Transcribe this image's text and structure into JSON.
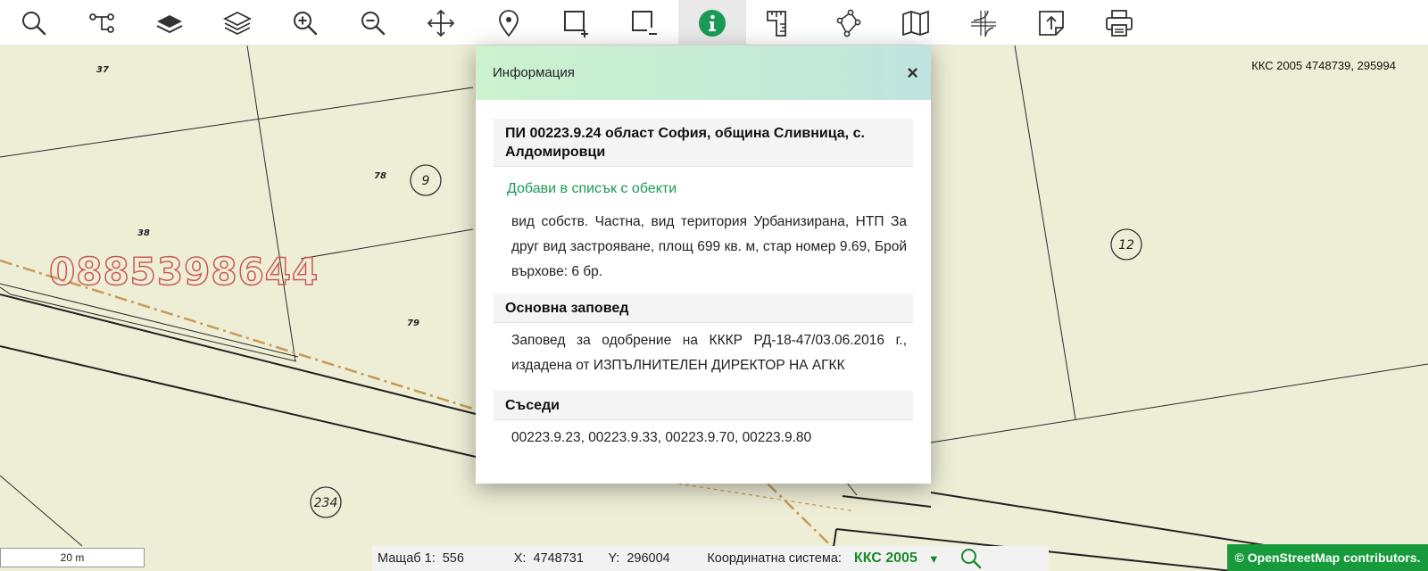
{
  "toolbar": {
    "tools": [
      {
        "name": "search-icon"
      },
      {
        "name": "route-icon"
      },
      {
        "name": "layer-stack-filled-icon"
      },
      {
        "name": "layers-icon"
      },
      {
        "name": "zoom-in-icon"
      },
      {
        "name": "zoom-out-icon"
      },
      {
        "name": "pan-icon"
      },
      {
        "name": "location-pin-icon"
      },
      {
        "name": "select-add-icon"
      },
      {
        "name": "select-remove-icon"
      },
      {
        "name": "info-icon",
        "active": true
      },
      {
        "name": "measure-icon"
      },
      {
        "name": "polygon-icon"
      },
      {
        "name": "map-icon"
      },
      {
        "name": "grid-coordinates-icon"
      },
      {
        "name": "export-icon"
      },
      {
        "name": "print-icon"
      }
    ],
    "accent": "#1a9a55"
  },
  "map": {
    "coordinate_readout": "ККС 2005 4748739, 295994",
    "watermark": "0885398644",
    "parcel_labels": [
      "37",
      "78",
      "38",
      "79"
    ],
    "circle_labels": [
      "9",
      "12",
      "234"
    ]
  },
  "panel": {
    "title": "Информация",
    "close_symbol": "×",
    "parcel_heading": "ПИ 00223.9.24 област София, община Сливница, с. Алдомировци",
    "add_link": "Добави в списък с обекти",
    "parcel_details": "вид собств. Частна, вид територия Урбанизирана, НТП За друг вид застрояване, площ 699 кв. м, стар номер 9.69, Брой върхове: 6 бр.",
    "order_heading": "Основна заповед",
    "order_text": "Заповед за одобрение на КККР РД-18-47/03.06.2016 г., издадена от ИЗПЪЛНИТЕЛЕН ДИРЕКТОР НА АГКК",
    "neighbors_heading": "Съседи",
    "neighbors_text": "00223.9.23, 00223.9.33, 00223.9.70, 00223.9.80"
  },
  "status": {
    "scale_bar_label": "20 m",
    "scale_label": "Мащаб 1:",
    "scale_value": "556",
    "x_label": "X:",
    "x_value": "4748731",
    "y_label": "Y:",
    "y_value": "296004",
    "crs_label": "Координатна система:",
    "crs_value": "ККС 2005",
    "crs_arrow": "▼"
  },
  "attribution": "© OpenStreetMap contributors."
}
